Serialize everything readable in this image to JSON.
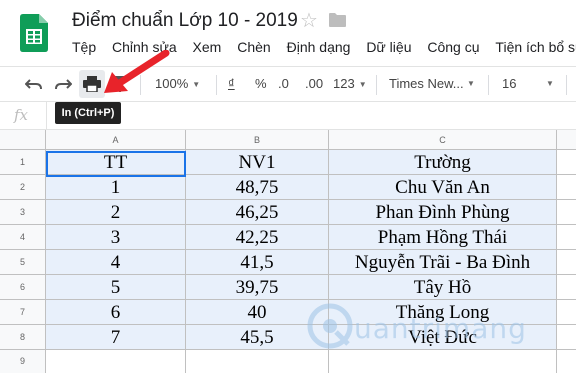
{
  "title": "Điểm chuẩn Lớp 10 - 2019",
  "menu": [
    "Tệp",
    "Chỉnh sửa",
    "Xem",
    "Chèn",
    "Định dạng",
    "Dữ liệu",
    "Công cụ",
    "Tiện ích bổ sun"
  ],
  "toolbar": {
    "zoom": "100%",
    "currency": "₫",
    "percent": "%",
    "decrease_decimal": ".0",
    "increase_decimal": ".00",
    "more_formats": "123",
    "font": "Times New...",
    "font_size": "16"
  },
  "tooltip": "In (Ctrl+P)",
  "formula_bar": {
    "fx": "fx"
  },
  "sheet": {
    "columns": [
      "A",
      "B",
      "C"
    ],
    "rows": [
      "1",
      "2",
      "3",
      "4",
      "5",
      "6",
      "7",
      "8",
      "9"
    ],
    "cells": [
      [
        "TT",
        "NV1",
        "Trường"
      ],
      [
        "1",
        "48,75",
        "Chu Văn An"
      ],
      [
        "2",
        "46,25",
        "Phan Đình Phùng"
      ],
      [
        "3",
        "42,25",
        "Phạm Hồng Thái"
      ],
      [
        "4",
        "41,5",
        "Nguyễn Trãi - Ba Đình"
      ],
      [
        "5",
        "39,75",
        "Tây Hồ"
      ],
      [
        "6",
        "40",
        "Thăng Long"
      ],
      [
        "7",
        "45,5",
        "Việt Đức"
      ]
    ]
  },
  "watermark": "uantrimang",
  "colors": {
    "cell_fill": "#e8f0fb",
    "selection": "#1a73e8",
    "arrow": "#e8232a",
    "sheets_green": "#0f9d58"
  }
}
